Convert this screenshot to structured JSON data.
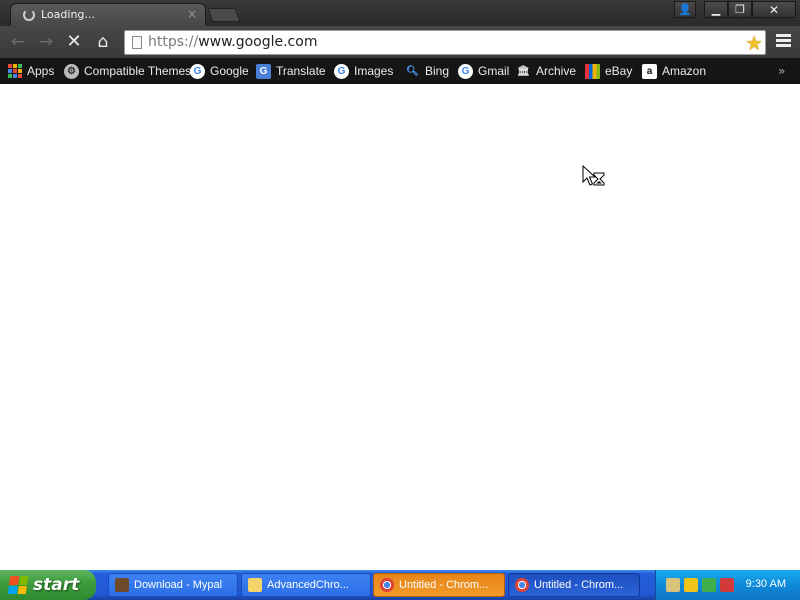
{
  "browser": {
    "tab": {
      "title": "Loading...",
      "close_glyph": "×"
    },
    "window_buttons": {
      "profile": "👤",
      "minimize": "▁",
      "restore": "❐",
      "close": "✕"
    },
    "nav": {
      "back": "←",
      "forward": "→",
      "stop": "✕",
      "home": "⌂"
    },
    "omnibox": {
      "url_scheme": "https://",
      "url_host": "www.google.com",
      "star": "★"
    },
    "bookmarks": [
      {
        "label": "Apps",
        "icon": "apps-grid-icon"
      },
      {
        "label": "Compatible Themes",
        "icon": "gear-icon"
      },
      {
        "label": "Google",
        "icon": "google-icon"
      },
      {
        "label": "Translate",
        "icon": "translate-icon"
      },
      {
        "label": "Images",
        "icon": "google-icon"
      },
      {
        "label": "Bing",
        "icon": "search-icon"
      },
      {
        "label": "Gmail",
        "icon": "google-icon"
      },
      {
        "label": "Archive",
        "icon": "archive-icon"
      },
      {
        "label": "eBay",
        "icon": "ebay-icon"
      },
      {
        "label": "Amazon",
        "icon": "amazon-icon"
      }
    ],
    "bookmarks_overflow": "»"
  },
  "taskbar": {
    "start_label": "start",
    "tasks": [
      {
        "label": "Download - Mypal",
        "icon": "mypal-icon",
        "state": "normal"
      },
      {
        "label": "AdvancedChro...",
        "icon": "folder-icon",
        "state": "normal"
      },
      {
        "label": "Untitled - Chrom...",
        "icon": "chrome-icon",
        "state": "active"
      },
      {
        "label": "Untitled - Chrom...",
        "icon": "chrome-icon",
        "state": "pressed"
      }
    ],
    "clock": "9:30 AM"
  },
  "colors": {
    "xp_blue": "#245edb",
    "start_green": "#3c9b3c",
    "active_task_orange": "#f09a2a",
    "star_yellow": "#f2c02c"
  }
}
